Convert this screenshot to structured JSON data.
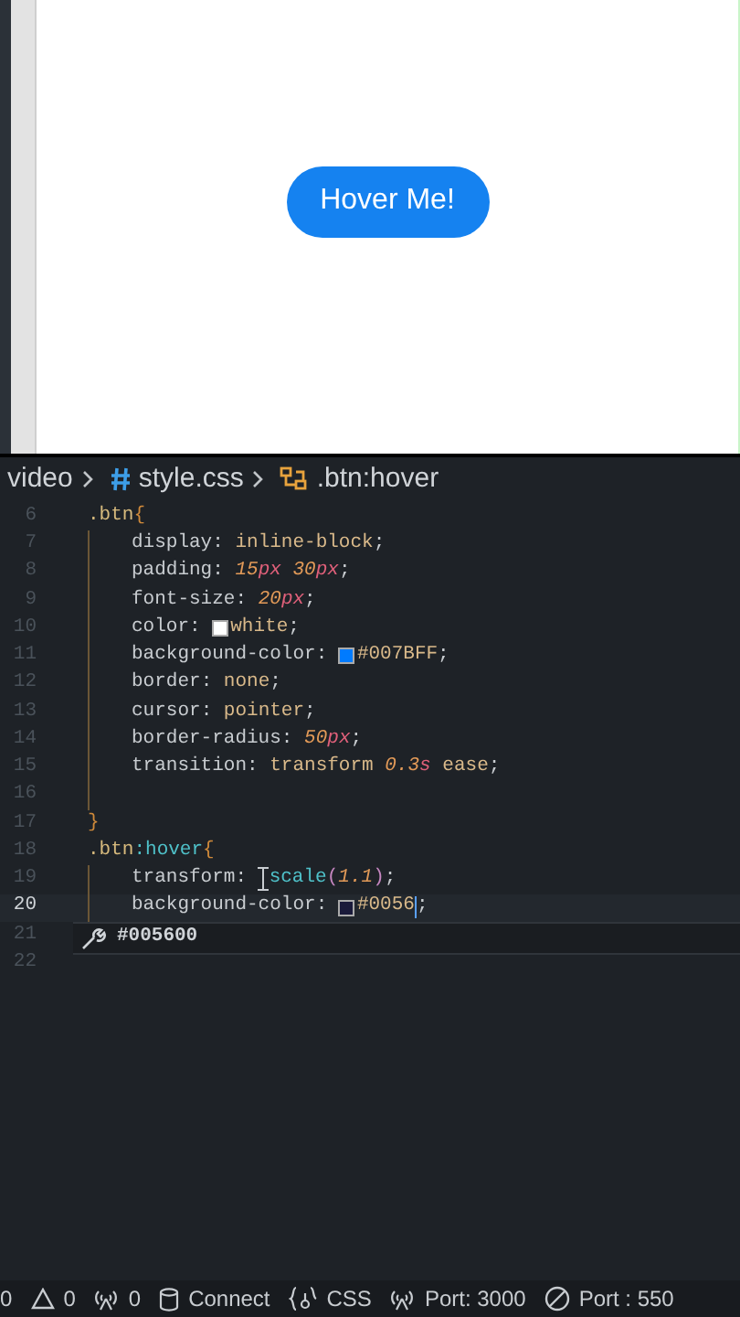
{
  "preview": {
    "button": "Hover Me!"
  },
  "breadcrumb": [
    {
      "kind": "folder",
      "text": "video"
    },
    {
      "kind": "css",
      "text": "style.css"
    },
    {
      "kind": "rule",
      "text": ".btn:hover"
    }
  ],
  "lines": [
    {
      "number": "6",
      "indented": false,
      "current": false,
      "tokens": [
        {
          "kind": "selector",
          "text": ".btn"
        },
        {
          "kind": "brace",
          "text": "{"
        }
      ]
    },
    {
      "number": "7",
      "indented": true,
      "current": false,
      "tokens": [
        {
          "kind": "property",
          "text": "display"
        },
        {
          "kind": "punct",
          "text": ": "
        },
        {
          "kind": "keyword",
          "text": "inline-block"
        },
        {
          "kind": "punct",
          "text": ";"
        }
      ]
    },
    {
      "number": "8",
      "indented": true,
      "current": false,
      "tokens": [
        {
          "kind": "property",
          "text": "padding"
        },
        {
          "kind": "punct",
          "text": ": "
        },
        {
          "kind": "number",
          "text": "15"
        },
        {
          "kind": "unit",
          "text": "px"
        },
        {
          "kind": "number",
          "text": " 30"
        },
        {
          "kind": "unit",
          "text": "px"
        },
        {
          "kind": "punct",
          "text": ";"
        }
      ]
    },
    {
      "number": "9",
      "indented": true,
      "current": false,
      "tokens": [
        {
          "kind": "property",
          "text": "font-size"
        },
        {
          "kind": "punct",
          "text": ": "
        },
        {
          "kind": "number",
          "text": "20"
        },
        {
          "kind": "unit",
          "text": "px"
        },
        {
          "kind": "punct",
          "text": ";"
        }
      ]
    },
    {
      "number": "10",
      "indented": true,
      "current": false,
      "tokens": [
        {
          "kind": "property",
          "text": "color"
        },
        {
          "kind": "punct",
          "text": ": "
        },
        {
          "kind": "swatch",
          "color": "#ffffff"
        },
        {
          "kind": "keyword",
          "text": "white"
        },
        {
          "kind": "punct",
          "text": ";"
        }
      ]
    },
    {
      "number": "11",
      "indented": true,
      "current": false,
      "tokens": [
        {
          "kind": "property",
          "text": "background-color"
        },
        {
          "kind": "punct",
          "text": ": "
        },
        {
          "kind": "swatch",
          "color": "#007bff"
        },
        {
          "kind": "keyword",
          "text": "#007BFF"
        },
        {
          "kind": "punct",
          "text": ";"
        }
      ]
    },
    {
      "number": "12",
      "indented": true,
      "current": false,
      "tokens": [
        {
          "kind": "property",
          "text": "border"
        },
        {
          "kind": "punct",
          "text": ": "
        },
        {
          "kind": "keyword",
          "text": "none"
        },
        {
          "kind": "punct",
          "text": ";"
        }
      ]
    },
    {
      "number": "13",
      "indented": true,
      "current": false,
      "tokens": [
        {
          "kind": "property",
          "text": "cursor"
        },
        {
          "kind": "punct",
          "text": ": "
        },
        {
          "kind": "keyword",
          "text": "pointer"
        },
        {
          "kind": "punct",
          "text": ";"
        }
      ]
    },
    {
      "number": "14",
      "indented": true,
      "current": false,
      "tokens": [
        {
          "kind": "property",
          "text": "border-radius"
        },
        {
          "kind": "punct",
          "text": ": "
        },
        {
          "kind": "number",
          "text": "50"
        },
        {
          "kind": "unit",
          "text": "px"
        },
        {
          "kind": "punct",
          "text": ";"
        }
      ]
    },
    {
      "number": "15",
      "indented": true,
      "current": false,
      "tokens": [
        {
          "kind": "property",
          "text": "transition"
        },
        {
          "kind": "punct",
          "text": ": "
        },
        {
          "kind": "keyword",
          "text": "transform "
        },
        {
          "kind": "number",
          "text": "0.3"
        },
        {
          "kind": "unit",
          "text": "s"
        },
        {
          "kind": "keyword",
          "text": " ease"
        },
        {
          "kind": "punct",
          "text": ";"
        }
      ]
    },
    {
      "number": "16",
      "indented": true,
      "current": false
    },
    {
      "number": "17",
      "indented": false,
      "current": false,
      "tokens": [
        {
          "kind": "brace",
          "text": "}"
        }
      ]
    },
    {
      "number": "18",
      "indented": false,
      "current": false,
      "tokens": [
        {
          "kind": "selector",
          "text": ".btn"
        },
        {
          "kind": "pseudo",
          "text": ":hover"
        },
        {
          "kind": "brace",
          "text": "{"
        }
      ]
    },
    {
      "number": "19",
      "indented": true,
      "current": false,
      "tokens": [
        {
          "kind": "property",
          "text": "transform"
        },
        {
          "kind": "punct",
          "text": ": "
        },
        {
          "kind": "pointer"
        },
        {
          "kind": "function",
          "text": "scale"
        },
        {
          "kind": "paren",
          "text": "("
        },
        {
          "kind": "number",
          "text": "1.1"
        },
        {
          "kind": "paren",
          "text": ")"
        },
        {
          "kind": "punct",
          "text": ";"
        }
      ]
    },
    {
      "number": "20",
      "indented": true,
      "current": true,
      "tokens": [
        {
          "kind": "property",
          "text": "background-color"
        },
        {
          "kind": "punct",
          "text": ": "
        },
        {
          "kind": "swatch",
          "color": "#1a1a3a"
        },
        {
          "kind": "keyword",
          "text": "#0056"
        },
        {
          "kind": "caret"
        },
        {
          "kind": "punct",
          "text": ";"
        }
      ]
    },
    {
      "number": "21",
      "indented": false,
      "current": false
    },
    {
      "number": "22",
      "indented": false,
      "current": false
    }
  ],
  "suggestion": {
    "text": "#005600"
  },
  "status_bar": [
    {
      "text": "0"
    },
    {
      "kind": "warning",
      "text": "0"
    },
    {
      "kind": "antenna",
      "text": "0"
    },
    {
      "kind": "database",
      "text": "Connect"
    },
    {
      "kind": "braces",
      "text": "CSS"
    },
    {
      "kind": "antenna",
      "text": "Port: 3000"
    },
    {
      "kind": "blocked",
      "text": "Port : 550"
    }
  ]
}
